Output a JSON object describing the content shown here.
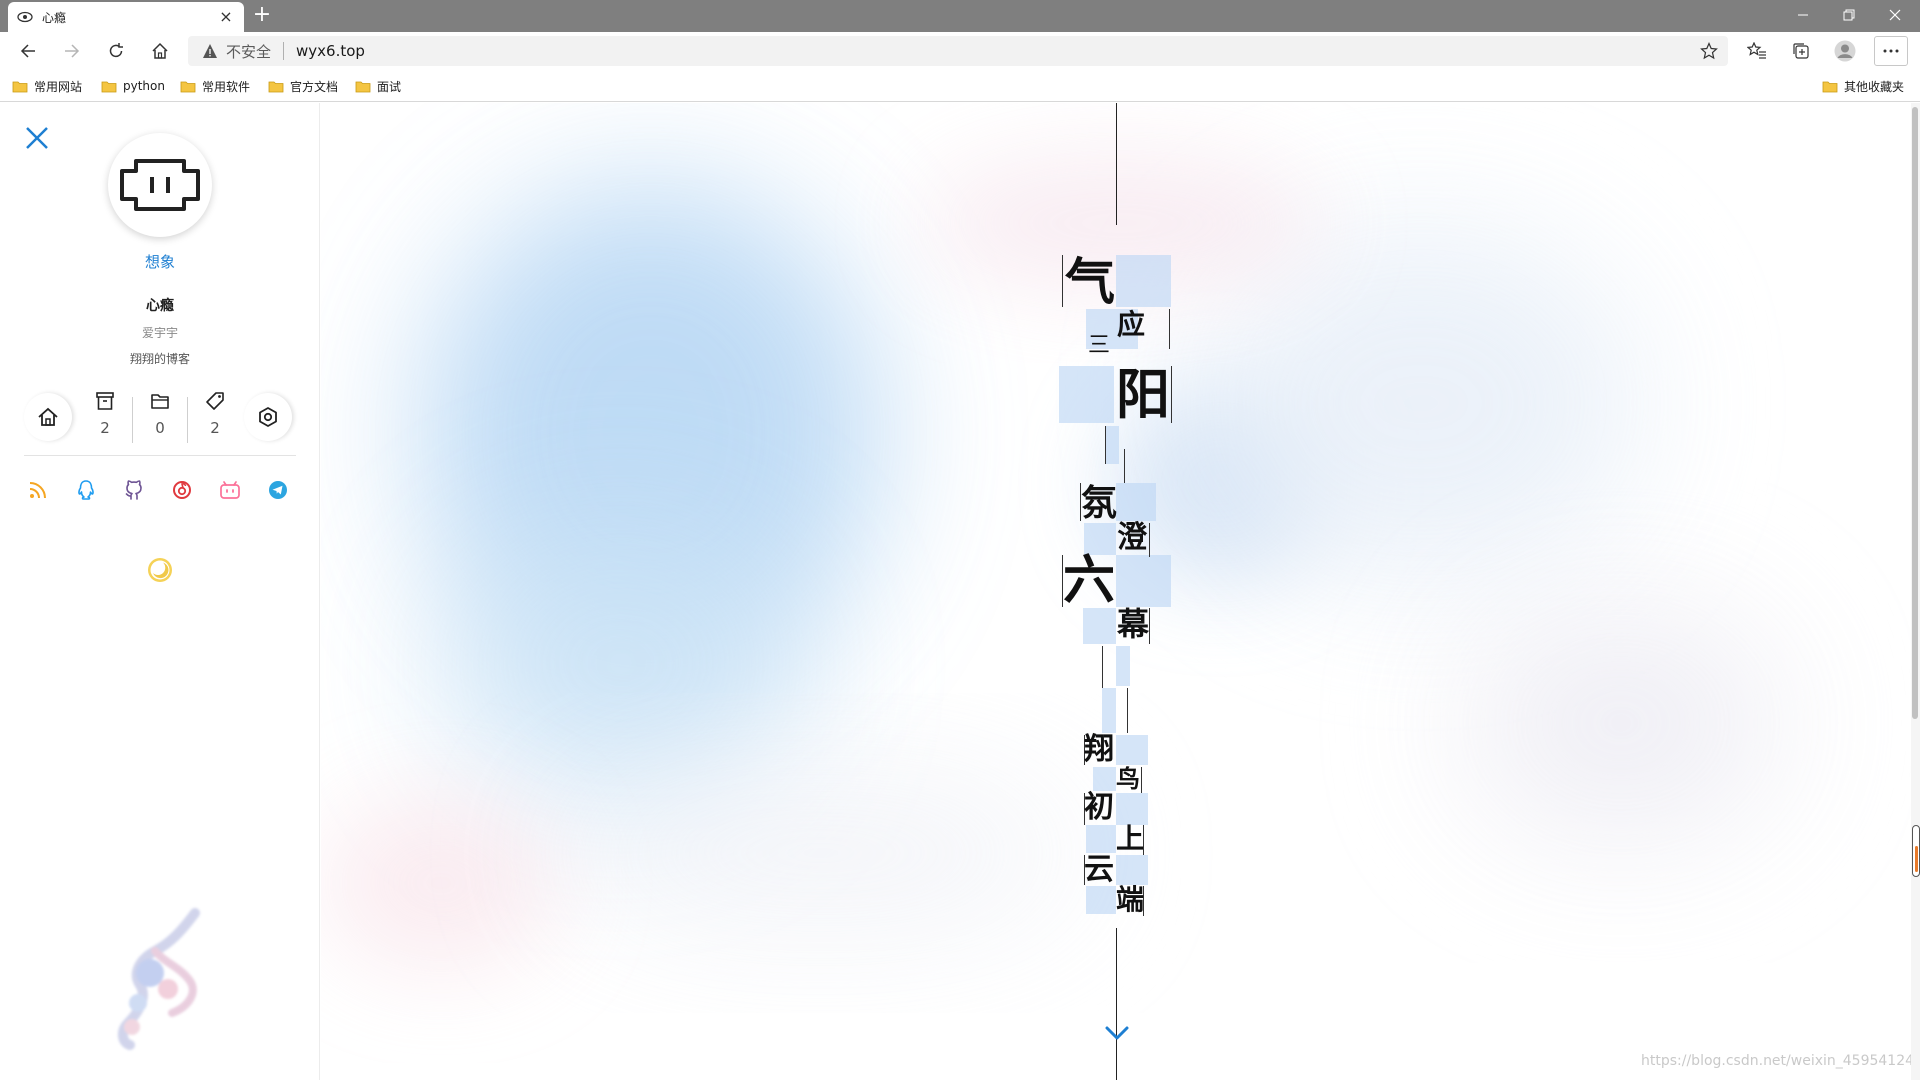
{
  "browser": {
    "tab_title": "心瘾",
    "tab_favicon": "eye-icon",
    "new_tab_label": "+",
    "insecure_label": "不安全",
    "url": "wyx6.top",
    "bookmarks": [
      {
        "label": "常用网站"
      },
      {
        "label": "python"
      },
      {
        "label": "常用软件"
      },
      {
        "label": "官方文档"
      },
      {
        "label": "面试"
      }
    ],
    "other_bookmarks": "其他收藏夹"
  },
  "sidebar": {
    "site_name": "想象",
    "author": "心瘾",
    "subtitle": "爱宇宇",
    "description": "翔翔的博客",
    "stats": [
      {
        "icon": "archive-icon",
        "count": "2"
      },
      {
        "icon": "folder-icon",
        "count": "0"
      },
      {
        "icon": "tag-icon",
        "count": "2"
      }
    ],
    "social_icons": [
      "rss-icon",
      "qq-icon",
      "github-icon",
      "netease-music-icon",
      "bilibili-icon",
      "telegram-icon"
    ],
    "colors": {
      "accent": "#1e7fd2",
      "rss": "#f5a623",
      "qq": "#1e9cf0",
      "github": "#6e5494",
      "music": "#e0393e",
      "bilibili": "#fb7299",
      "telegram": "#2ca5e0",
      "theme": "#f0c94a"
    }
  },
  "poem": {
    "lines": [
      {
        "big": "气",
        "small": [
          "应",
          "三"
        ]
      },
      {
        "big": "阳",
        "small": []
      },
      {
        "big": "氛",
        "small": [
          "澄"
        ]
      },
      {
        "big": "六",
        "small": [
          "幕"
        ]
      },
      {
        "big": "翔",
        "small": [
          "鸟"
        ]
      },
      {
        "big": "初",
        "small": [
          "上"
        ]
      },
      {
        "big": "云",
        "small": [
          "端"
        ]
      }
    ]
  },
  "watermark": "https://blog.csdn.net/weixin_45954124"
}
